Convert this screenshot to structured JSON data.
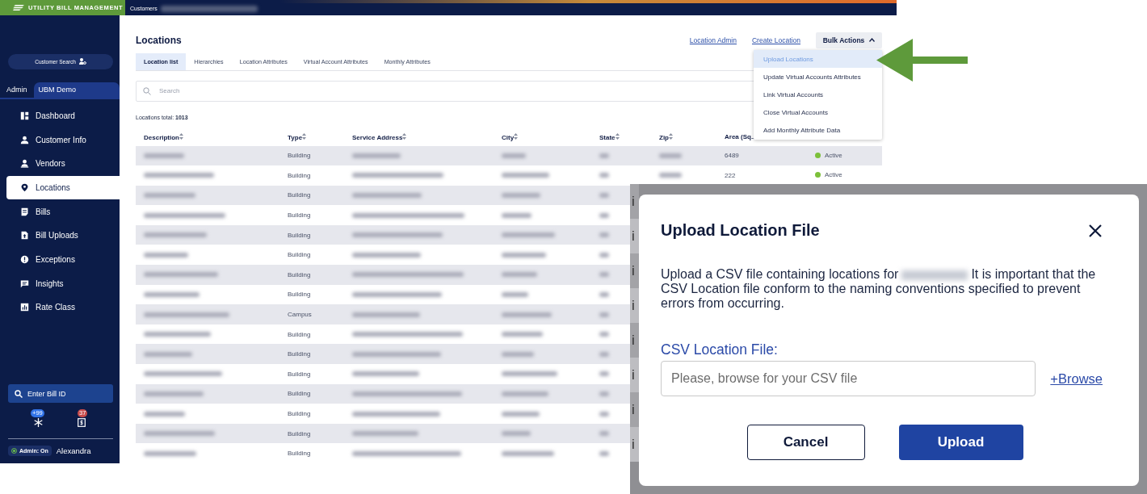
{
  "app": {
    "logo": "UTILITY BILL MANAGEMENT",
    "breadcrumb": "Customers"
  },
  "sidebar": {
    "customer_search": "Customer Search",
    "scope_tabs": [
      {
        "label": "Admin",
        "selected": false
      },
      {
        "label": "UBM Demo",
        "selected": true
      }
    ],
    "items": [
      {
        "label": "Dashboard",
        "selected": false
      },
      {
        "label": "Customer Info",
        "selected": false
      },
      {
        "label": "Vendors",
        "selected": false
      },
      {
        "label": "Locations",
        "selected": true
      },
      {
        "label": "Bills",
        "selected": false
      },
      {
        "label": "Bill Uploads",
        "selected": false
      },
      {
        "label": "Exceptions",
        "selected": false
      },
      {
        "label": "Insights",
        "selected": false
      },
      {
        "label": "Rate Class",
        "selected": false
      }
    ],
    "bill_search": {
      "placeholder": "Enter Bill ID"
    },
    "badges": [
      "+99",
      "37"
    ],
    "admin_chip": {
      "label": "Admin: On",
      "on": true
    },
    "user": "Alexandra"
  },
  "page": {
    "title": "Locations",
    "links": [
      "Location Admin",
      "Create Location"
    ],
    "bulk_actions": {
      "label": "Bulk Actions",
      "expanded": true,
      "items": [
        {
          "label": "Upload Locations",
          "selected": true
        },
        {
          "label": "Update Virtual Accounts Attributes",
          "selected": false
        },
        {
          "label": "Link Virtual Accounts",
          "selected": false
        },
        {
          "label": "Close Virtual Accounts",
          "selected": false
        },
        {
          "label": "Add Monthly Attribute Data",
          "selected": false
        }
      ]
    },
    "tabs": [
      {
        "label": "Location list",
        "selected": true
      },
      {
        "label": "Hierarchies",
        "selected": false
      },
      {
        "label": "Location Attributes",
        "selected": false
      },
      {
        "label": "Virtual Account Attributes",
        "selected": false
      },
      {
        "label": "Monthly Attributes",
        "selected": false
      }
    ],
    "search": {
      "placeholder": "Search"
    },
    "total_label": "Locations total:",
    "total": "1013"
  },
  "table": {
    "columns": [
      "Description",
      "Type",
      "Service Address",
      "City",
      "State",
      "Zip",
      "Area (Sq..."
    ],
    "rows": [
      {
        "type": "Building",
        "area": "6489",
        "status": "Active"
      },
      {
        "type": "Building",
        "area": "222",
        "status": "Active"
      },
      {
        "type": "Building"
      },
      {
        "type": "Building"
      },
      {
        "type": "Building"
      },
      {
        "type": "Building"
      },
      {
        "type": "Building"
      },
      {
        "type": "Building"
      },
      {
        "type": "Campus"
      },
      {
        "type": "Building"
      },
      {
        "type": "Building"
      },
      {
        "type": "Building"
      },
      {
        "type": "Building"
      },
      {
        "type": "Building"
      },
      {
        "type": "Building"
      },
      {
        "type": "Building"
      }
    ]
  },
  "dialog": {
    "title": "Upload Location File",
    "text_before": "Upload a CSV file containing locations for",
    "text_after": "It is important that the CSV Location file conform to the naming conventions specified to prevent errors from occurring.",
    "field_label": "CSV Location File:",
    "field_placeholder": "Please, browse for your CSV file",
    "browse": "+Browse",
    "buttons": [
      "Cancel",
      "Upload"
    ],
    "backdrop_left": [
      "i",
      "i",
      "i",
      "i",
      "i",
      "i",
      "i",
      "i"
    ]
  }
}
